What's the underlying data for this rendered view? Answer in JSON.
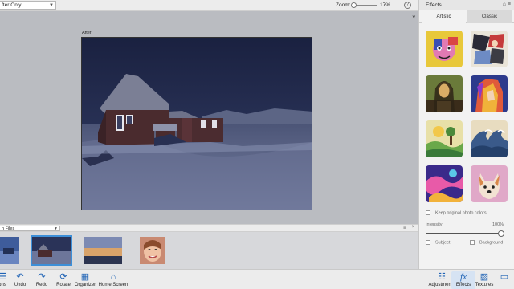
{
  "top": {
    "view_mode": "fter Only",
    "zoom_label": "Zoom:",
    "zoom_value": "17%",
    "zoom_level_percent": 17
  },
  "canvas": {
    "after_label": "After",
    "close_glyph": "×"
  },
  "bin": {
    "source": "n Files",
    "menu_glyph": "≡",
    "close_glyph": "×",
    "thumbnails": [
      "photo-1",
      "photo-2-selected",
      "photo-3",
      "photo-4-portrait"
    ]
  },
  "toolbar": {
    "left": [
      {
        "label": "ons",
        "icon": "options-icon"
      },
      {
        "label": "Undo",
        "icon": "undo-icon"
      },
      {
        "label": "Redo",
        "icon": "redo-icon"
      },
      {
        "label": "Rotate",
        "icon": "rotate-icon"
      },
      {
        "label": "Organizer",
        "icon": "organizer-icon"
      },
      {
        "label": "Home Screen",
        "icon": "home-icon"
      }
    ],
    "right": [
      {
        "label": "Adjustments",
        "icon": "sliders-icon"
      },
      {
        "label": "Effects",
        "icon": "fx-icon"
      },
      {
        "label": "Textures",
        "icon": "textures-icon"
      }
    ],
    "effects_glyph": "fx"
  },
  "panel": {
    "title": "Effects",
    "tabs": [
      "Artistic",
      "Classic"
    ],
    "effects": [
      "abstract-portrait",
      "cubist-collage",
      "mona-lisa",
      "colorful-portrait",
      "sunny-landscape",
      "great-wave",
      "purple-abstract",
      "painted-dog"
    ],
    "keep_colors_label": "Keep original photo colors",
    "intensity_label": "Intensity",
    "intensity_value": "100%",
    "subject_label": "Subject",
    "background_label": "Background"
  },
  "colors": {
    "accent": "#1f63b5",
    "selection": "#3d8fd8",
    "canvas_bg": "#babcc1"
  }
}
